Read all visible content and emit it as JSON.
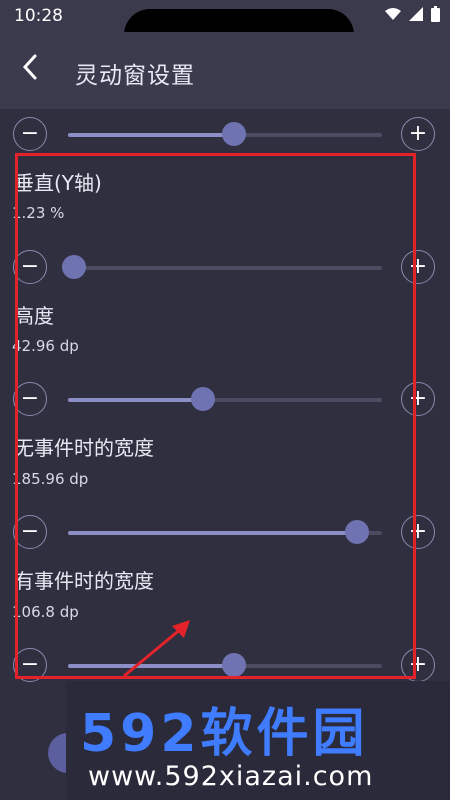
{
  "status": {
    "time": "10:28"
  },
  "appbar": {
    "title": "灵动窗设置"
  },
  "sliders": [
    {
      "id": "top",
      "label": "",
      "value": "",
      "fraction": 0.53
    },
    {
      "id": "vertical",
      "label": "垂直(Y轴)",
      "value": "1.23 %",
      "fraction": 0.02
    },
    {
      "id": "height",
      "label": "高度",
      "value": "42.96 dp",
      "fraction": 0.43
    },
    {
      "id": "width-no-event",
      "label": "无事件时的宽度",
      "value": "185.96 dp",
      "fraction": 0.92
    },
    {
      "id": "width-with-event",
      "label": "有事件时的宽度",
      "value": "106.8 dp",
      "fraction": 0.53
    }
  ],
  "buttons": {
    "minus": "−",
    "plus": "+"
  },
  "watermark": {
    "brand": "592软件园",
    "url": "www.592xiazai.com"
  },
  "colors": {
    "highlight": "#e3222a",
    "slider": "#6f73b1",
    "brand": "#3f7cff"
  }
}
